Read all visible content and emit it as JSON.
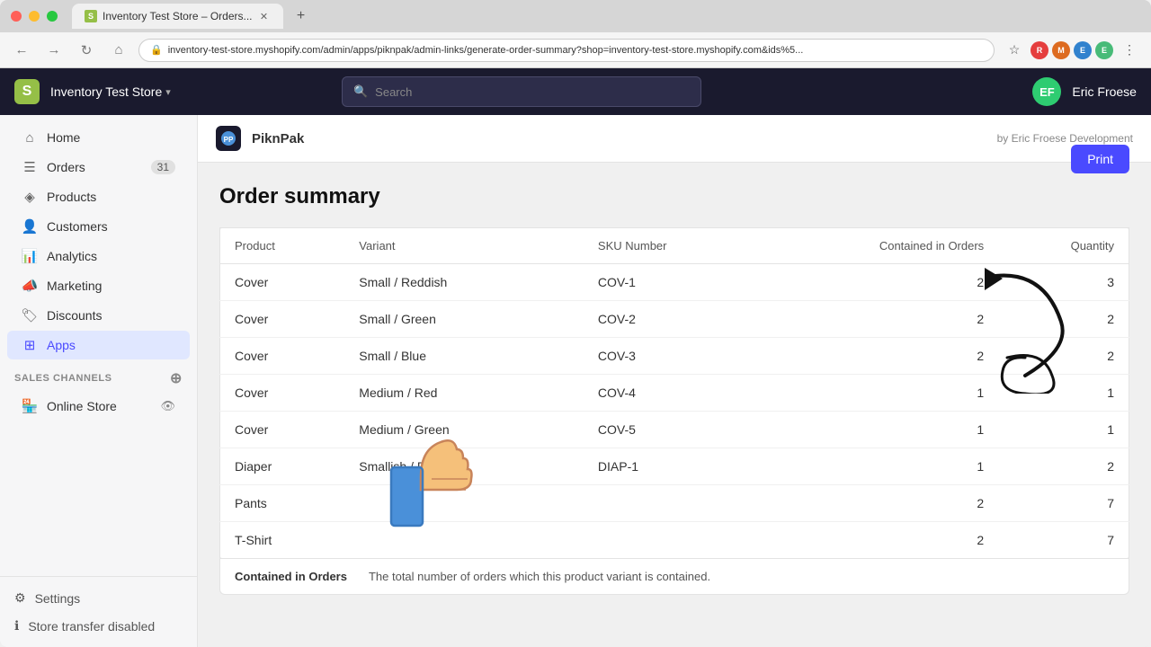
{
  "browser": {
    "tab_title": "Inventory Test Store – Orders...",
    "tab_favicon": "S",
    "address": "inventory-test-store.myshopify.com/admin/apps/piknpak/admin-links/generate-order-summary?shop=inventory-test-store.myshopify.com&ids%5...",
    "new_tab_label": "+"
  },
  "topbar": {
    "store_name": "Inventory Test Store",
    "search_placeholder": "Search",
    "user_initials": "EF",
    "user_name": "Eric Froese"
  },
  "sidebar": {
    "nav_items": [
      {
        "id": "home",
        "label": "Home",
        "icon": "⌂",
        "badge": null,
        "active": false
      },
      {
        "id": "orders",
        "label": "Orders",
        "icon": "≡",
        "badge": "31",
        "active": false
      },
      {
        "id": "products",
        "label": "Products",
        "icon": "◈",
        "badge": null,
        "active": false
      },
      {
        "id": "customers",
        "label": "Customers",
        "icon": "👤",
        "badge": null,
        "active": false
      },
      {
        "id": "analytics",
        "label": "Analytics",
        "icon": "📊",
        "badge": null,
        "active": false
      },
      {
        "id": "marketing",
        "label": "Marketing",
        "icon": "📣",
        "badge": null,
        "active": false
      },
      {
        "id": "discounts",
        "label": "Discounts",
        "icon": "🏷",
        "badge": null,
        "active": false
      },
      {
        "id": "apps",
        "label": "Apps",
        "icon": "⊞",
        "badge": null,
        "active": true
      }
    ],
    "sales_channels_label": "SALES CHANNELS",
    "online_store_label": "Online Store",
    "settings_label": "Settings",
    "store_transfer_label": "Store transfer disabled"
  },
  "app": {
    "logo_text": "PP",
    "name": "PiknPak",
    "credit": "by Eric Froese Development",
    "page_title": "Order summary",
    "print_btn": "Print"
  },
  "table": {
    "columns": [
      "Product",
      "Variant",
      "SKU Number",
      "Contained in Orders",
      "Quantity"
    ],
    "rows": [
      {
        "product": "Cover",
        "variant": "Small / Reddish",
        "sku": "COV-1",
        "contained": "2",
        "quantity": "3"
      },
      {
        "product": "Cover",
        "variant": "Small / Green",
        "sku": "COV-2",
        "contained": "2",
        "quantity": "2"
      },
      {
        "product": "Cover",
        "variant": "Small / Blue",
        "sku": "COV-3",
        "contained": "2",
        "quantity": "2"
      },
      {
        "product": "Cover",
        "variant": "Medium / Red",
        "sku": "COV-4",
        "contained": "1",
        "quantity": "1"
      },
      {
        "product": "Cover",
        "variant": "Medium / Green",
        "sku": "COV-5",
        "contained": "1",
        "quantity": "1"
      },
      {
        "product": "Diaper",
        "variant": "Smallish / Reddish",
        "sku": "DIAP-1",
        "contained": "1",
        "quantity": "2"
      },
      {
        "product": "Pants",
        "variant": "",
        "sku": "",
        "contained": "2",
        "quantity": "7"
      },
      {
        "product": "T-Shirt",
        "variant": "",
        "sku": "",
        "contained": "2",
        "quantity": "7"
      }
    ],
    "footer_term": "Contained in Orders",
    "footer_desc": "The total number of orders which this product variant is contained."
  }
}
